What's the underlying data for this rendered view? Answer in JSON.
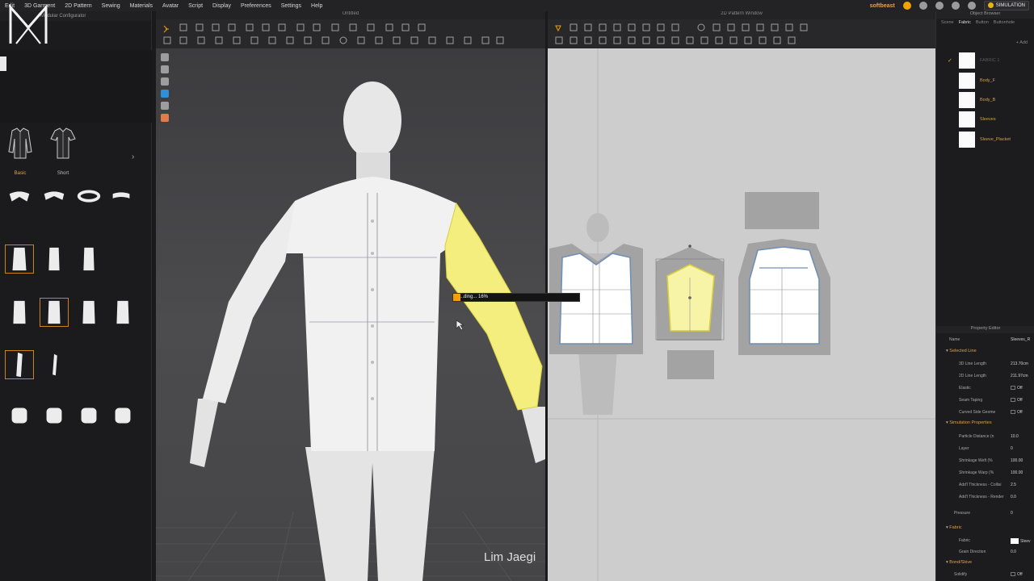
{
  "menu": {
    "items": [
      "Edit",
      "3D Garment",
      "2D Pattern",
      "Sewing",
      "Materials",
      "Avatar",
      "Script",
      "Display",
      "Preferences",
      "Settings",
      "Help"
    ],
    "username": "softbeast",
    "simulation_label": "SIMULATION"
  },
  "logo_text": "M",
  "left_panel": {
    "title": "Modular Configurator",
    "block_tabs": [
      {
        "label": "Basic",
        "active": true
      },
      {
        "label": "Short",
        "active": false
      }
    ]
  },
  "viewport3d": {
    "title": "Untitled",
    "progress_text": "...ding... 16%",
    "progress_value": 0.06
  },
  "viewport2d": {
    "title": "2D Pattern Window"
  },
  "right_panel": {
    "title": "Object Browser",
    "tabs": [
      "Scene",
      "Fabric",
      "Button",
      "Buttonhole"
    ],
    "active_tab": "Fabric",
    "add_label": "+ Add",
    "fabrics": [
      {
        "name": "FABRIC 1",
        "checked": true
      },
      {
        "name": "Body_F",
        "checked": false
      },
      {
        "name": "Body_B",
        "checked": false
      },
      {
        "name": "Sleeves",
        "checked": false
      },
      {
        "name": "Sleeve_Placket",
        "checked": false
      }
    ],
    "property_editor": {
      "title": "Property Editor",
      "name_label": "Name",
      "name_value": "Sleeves_R",
      "sections": {
        "selected_line": "Selected Line",
        "simulation": "Simulation Properties",
        "fabric": "Fabric",
        "bond": "Bond/Skive"
      },
      "rows": [
        {
          "k": "3D Line Length",
          "v": "213.70cm"
        },
        {
          "k": "2D Line Length",
          "v": "211.97cm"
        },
        {
          "k": "Elastic",
          "v": "Off"
        },
        {
          "k": "Seam Taping",
          "v": "Off"
        },
        {
          "k": "Curved Side Geome",
          "v": "Off"
        },
        {
          "k": "Particle Distance (n",
          "v": "10.0"
        },
        {
          "k": "Layer",
          "v": "0"
        },
        {
          "k": "Shrinkage Weft (%",
          "v": "100.00"
        },
        {
          "k": "Shrinkage Warp (%",
          "v": "100.00"
        },
        {
          "k": "Add'l Thickness - Collisi",
          "v": "2.5"
        },
        {
          "k": "Add'l Thickness - Render",
          "v": "0.0"
        },
        {
          "k": "Pressure",
          "v": "0"
        },
        {
          "k": "Fabric",
          "v": "Sleev"
        },
        {
          "k": "Grain Direction",
          "v": "0.0"
        },
        {
          "k": "Solidify",
          "v": "Off"
        }
      ]
    }
  },
  "caption": "Lim Jaegi",
  "colors": {
    "accent": "#e8a14a",
    "highlight_yellow": "#f4ee7e",
    "pattern_outline": "#6f8fb5",
    "seam_gray": "#8c8c8c"
  }
}
